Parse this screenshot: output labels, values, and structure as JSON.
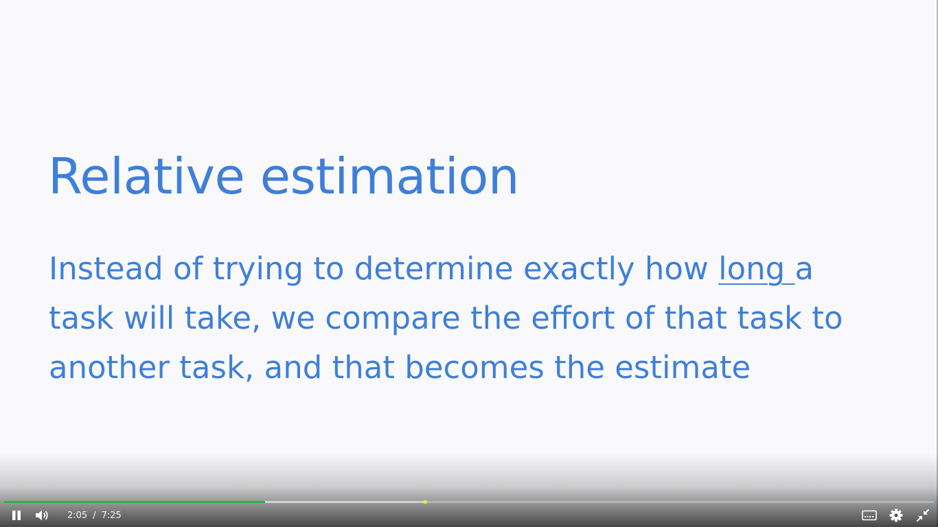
{
  "slide": {
    "title": "Relative estimation",
    "body": {
      "line1_before": "Instead of trying to determine exactly how ",
      "line1_underlined": "long ",
      "line1_after": "a",
      "line2": "task will take, we compare the effort of that task to",
      "line3": "another task, and that becomes the estimate"
    }
  },
  "player": {
    "current_time": "2:05",
    "separator": "/",
    "duration": "7:25",
    "played_fraction": 0.281,
    "buffered_fraction": 0.455,
    "icons": {
      "pause": "pause-icon",
      "volume": "volume-icon",
      "captions": "captions-icon",
      "settings": "gear-icon",
      "exit_fullscreen": "exit-fullscreen-icon"
    },
    "colors": {
      "progress": "#2fb24b",
      "chapter_marker": "#f6e81a",
      "slide_text": "#3f7fd9"
    }
  }
}
